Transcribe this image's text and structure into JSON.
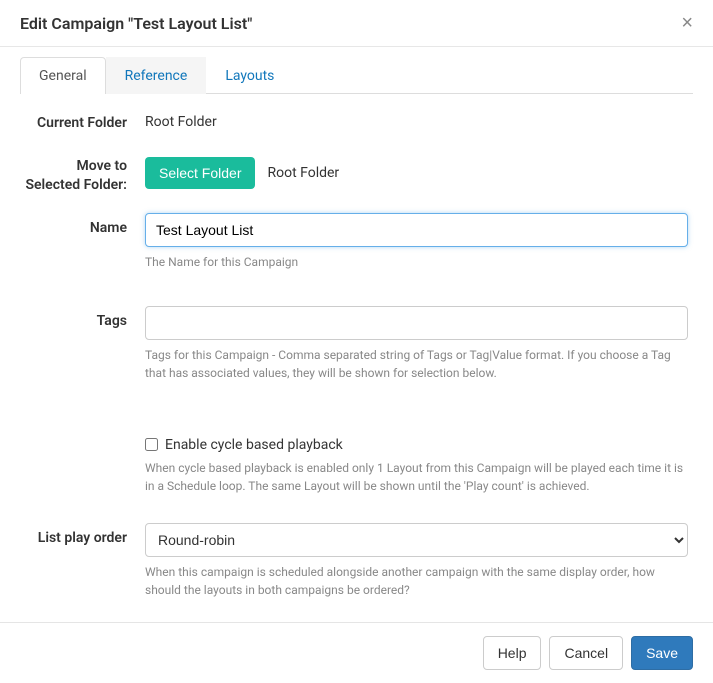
{
  "header": {
    "title": "Edit Campaign \"Test Layout List\""
  },
  "tabs": {
    "general": "General",
    "reference": "Reference",
    "layouts": "Layouts"
  },
  "form": {
    "currentFolder": {
      "label": "Current Folder",
      "value": "Root Folder"
    },
    "moveFolder": {
      "label": "Move to Selected Folder:",
      "button": "Select Folder",
      "value": "Root Folder"
    },
    "name": {
      "label": "Name",
      "value": "Test Layout List",
      "help": "The Name for this Campaign"
    },
    "tags": {
      "label": "Tags",
      "value": "",
      "help": "Tags for this Campaign - Comma separated string of Tags or Tag|Value format. If you choose a Tag that has associated values, they will be shown for selection below."
    },
    "cyclePlayback": {
      "label": "Enable cycle based playback",
      "help": "When cycle based playback is enabled only 1 Layout from this Campaign will be played each time it is in a Schedule loop. The same Layout will be shown until the 'Play count' is achieved."
    },
    "listPlayOrder": {
      "label": "List play order",
      "value": "Round-robin",
      "help": "When this campaign is scheduled alongside another campaign with the same display order, how should the layouts in both campaigns be ordered?"
    }
  },
  "footer": {
    "help": "Help",
    "cancel": "Cancel",
    "save": "Save"
  }
}
